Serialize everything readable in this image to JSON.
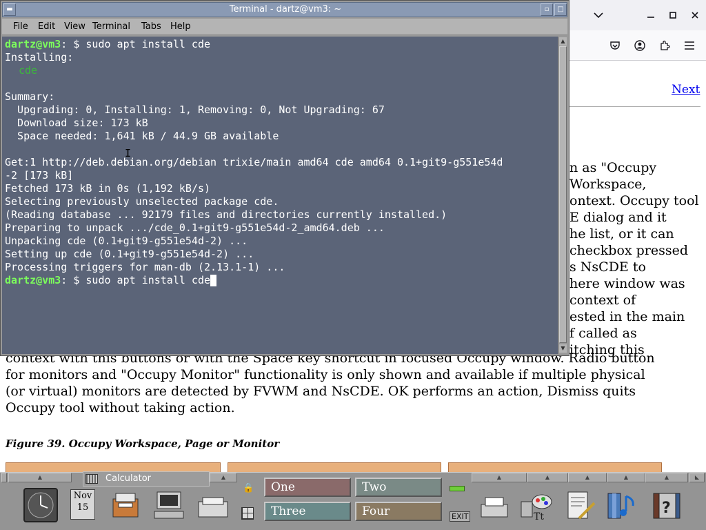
{
  "browser": {
    "next_link": "Next",
    "right_lines": [
      "n as \"Occupy",
      "Workspace,",
      "ontext. Occupy tool",
      "E dialog and it",
      "he list, or it can",
      "checkbox pressed",
      "s NsCDE to",
      "here window was",
      "context of",
      "ested in the main",
      "f called as",
      "itching this"
    ],
    "bottom_lines": [
      "context with this buttons or with the Space key shortcut in focused Occupy window. Radio button",
      "for monitors and \"Occupy Monitor\" functionality is only shown and available if multiple physical",
      "(or virtual) monitors are detected by FVWM and NsCDE. OK performs an action, Dismiss quits",
      "Occupy tool without taking action."
    ],
    "figure_caption": "Figure 39. Occupy Workspace, Page or Monitor"
  },
  "terminal": {
    "title": "Terminal - dartz@vm3: ~",
    "menu": [
      "File",
      "Edit",
      "View",
      "Terminal",
      "Tabs",
      "Help"
    ],
    "prompt_user": "dartz@vm3",
    "prompt_rest": ": $ ",
    "command1": "sudo apt install cde",
    "output_lines": [
      "Installing:",
      "",
      "",
      "Summary:",
      "  Upgrading: 0, Installing: 1, Removing: 0, Not Upgrading: 67",
      "  Download size: 173 kB",
      "  Space needed: 1,641 kB / 44.9 GB available",
      "",
      "Get:1 http://deb.debian.org/debian trixie/main amd64 cde amd64 0.1+git9-g551e54d",
      "-2 [173 kB]",
      "Fetched 173 kB in 0s (1,192 kB/s)",
      "Selecting previously unselected package cde.",
      "(Reading database ... 92179 files and directories currently installed.)",
      "Preparing to unpack .../cde_0.1+git9-g551e54d-2_amd64.deb ...",
      "Unpacking cde (0.1+git9-g551e54d-2) ...",
      "Setting up cde (0.1+git9-g551e54d-2) ...",
      "Processing triggers for man-db (2.13.1-1) ..."
    ],
    "package_line": "cde",
    "command2": "sudo apt install cde"
  },
  "panel": {
    "calculator_label": "Calculator",
    "calendar_month": "Nov",
    "calendar_day": "15",
    "workspaces": [
      "One",
      "Two",
      "Three",
      "Four"
    ],
    "exit_label": "EXIT"
  },
  "colors": {
    "terminal_bg": "#5b6478",
    "prompt_green": "#7cfc5c",
    "workspace_one": "#8a6a6a",
    "workspace_two": "#7a8a86",
    "workspace_three": "#6a8a8a",
    "workspace_four": "#8a7a62"
  }
}
